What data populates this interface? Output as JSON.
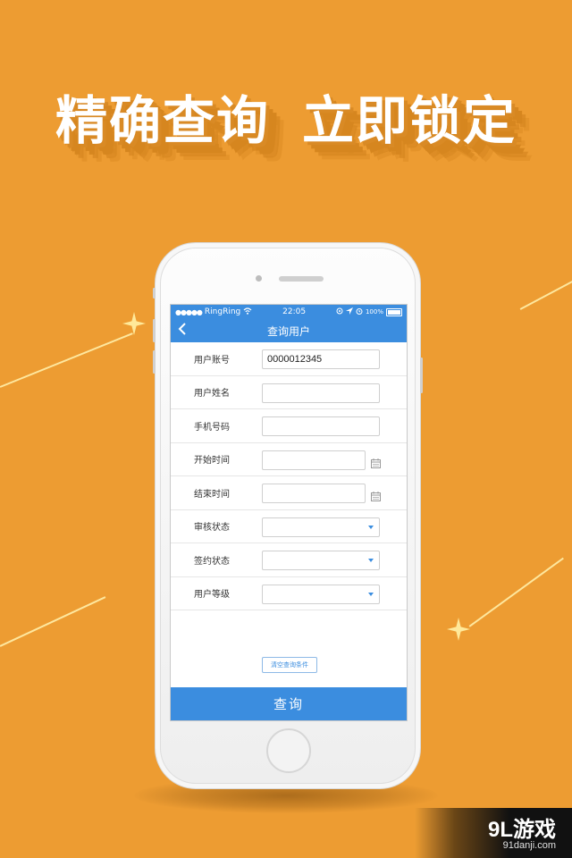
{
  "headline": {
    "part1": "精确查询",
    "part2": "立即锁定"
  },
  "status_bar": {
    "carrier": "RingRing",
    "time": "22:05",
    "battery": "100%"
  },
  "nav": {
    "title": "查询用户",
    "back_icon": "chevron-left-icon"
  },
  "form": {
    "fields": [
      {
        "label": "用户账号",
        "value": "0000012345",
        "type": "text"
      },
      {
        "label": "用户姓名",
        "value": "",
        "type": "text"
      },
      {
        "label": "手机号码",
        "value": "",
        "type": "text"
      },
      {
        "label": "开始时间",
        "value": "",
        "type": "date"
      },
      {
        "label": "结束时间",
        "value": "",
        "type": "date"
      },
      {
        "label": "审核状态",
        "value": "",
        "type": "select"
      },
      {
        "label": "签约状态",
        "value": "",
        "type": "select"
      },
      {
        "label": "用户等级",
        "value": "",
        "type": "select"
      }
    ]
  },
  "actions": {
    "clear_label": "清空查询条件",
    "query_label": "查询"
  },
  "watermark": {
    "brand": "9L游戏",
    "url": "91danji.com"
  },
  "colors": {
    "background": "#ED9C32",
    "accent": "#3B8DDF"
  }
}
